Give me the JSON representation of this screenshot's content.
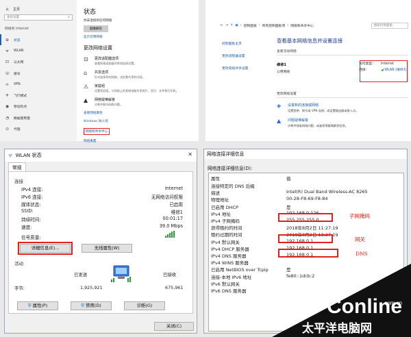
{
  "settings": {
    "home": "主页",
    "search_placeholder": "查找设置",
    "section": "网络和 Internet",
    "nav": [
      {
        "icon": "⊕",
        "label": "状态"
      },
      {
        "icon": "ᯤ",
        "label": "WLAN"
      },
      {
        "icon": "⊡",
        "label": "以太网"
      },
      {
        "icon": "☏",
        "label": "拨号"
      },
      {
        "icon": "∞",
        "label": "VPN"
      },
      {
        "icon": "✈",
        "label": "飞行模式"
      },
      {
        "icon": "◉",
        "label": "移动热点"
      },
      {
        "icon": "◔",
        "label": "数据使用量"
      },
      {
        "icon": "⊙",
        "label": "代理"
      }
    ],
    "title": "状态",
    "status_text": "你未连接到任何网络",
    "troubleshoot_btn": "疑难解答",
    "available_link": "显示可用网络",
    "change_title": "更改网络设置",
    "options": [
      {
        "icon": "⊡",
        "title": "更改适配器选项",
        "desc": "查看网络适配器并更改连接设置。"
      },
      {
        "icon": "⌂",
        "title": "共享选项",
        "desc": "针对连接到的网络，决定要共享的内容。"
      },
      {
        "icon": "⚠",
        "title": "家庭组",
        "desc": "设置家庭组，与网络上的其他电脑共享照片、音乐、文件和打印机。"
      },
      {
        "icon": "▲",
        "title": "网络疑难解答",
        "desc": "诊断并解决网络问题。"
      }
    ],
    "links": [
      "查看网络属性",
      "Windows 防火墙",
      "网络和共享中心",
      "网络重置"
    ]
  },
  "nsc": {
    "breadcrumb": [
      "控制面板",
      "所有控制面板项",
      "网络和共享中心"
    ],
    "search": "搜索控制面板",
    "left_links": [
      "控制面板主页",
      "更改适配器设置",
      "更改高级共享设置"
    ],
    "heading": "查看基本网络信息并设置连接",
    "active_networks": "查看活动网络",
    "network_name": "维修1",
    "network_kind": "公用网络",
    "access_type_label": "访问类型：",
    "access_type_value": "Internet",
    "connection_label": "连接：",
    "connection_value": "WLAN (维修1)",
    "change_settings": "更改网络设置",
    "actions": [
      {
        "icon": "◈",
        "title": "设置新的连接或网络",
        "desc": "设置宽带、拨号或 VPN 连接；或设置路由器或接入点。"
      },
      {
        "icon": "▲",
        "title": "问题疑难解答",
        "desc": "诊断并修复网络问题，或者获得疑难解答信息。"
      }
    ]
  },
  "wlan": {
    "title": "WLAN 状态",
    "close": "✕",
    "tab": "常规",
    "connection_group": "连接",
    "fields": [
      {
        "label": "IPv4 连接:",
        "value": "Internet"
      },
      {
        "label": "IPv6 连接:",
        "value": "无网络访问权限"
      },
      {
        "label": "媒体状态:",
        "value": "已启用"
      },
      {
        "label": "SSID:",
        "value": "维修1"
      },
      {
        "label": "持续时间:",
        "value": "00:01:17"
      },
      {
        "label": "速度:",
        "value": "39.0 Mbps"
      }
    ],
    "signal_label": "信号质量:",
    "details_btn": "详细信息(E)...",
    "wireless_props_btn": "无线属性(W)",
    "activity_group": "活动",
    "sent": "已发送",
    "received": "已接收",
    "bytes_label": "字节:",
    "bytes_sent": "1,925,921",
    "bytes_received": "675,961",
    "props_btn": "属性(P)",
    "disable_btn": "禁用(D)",
    "diagnose_btn": "诊断(G)",
    "close_btn": "关闭(C)"
  },
  "details": {
    "title": "网络连接详细信息",
    "label": "网络连接详细信息(D):",
    "header": {
      "p": "属性",
      "v": "值"
    },
    "rows": [
      {
        "p": "连接特定的 DNS 后缀",
        "v": ""
      },
      {
        "p": "描述",
        "v": "Intel(R) Dual Band Wireless-AC 8265"
      },
      {
        "p": "物理地址",
        "v": "00-28-F8-69-F8-84"
      },
      {
        "p": "已启用 DHCP",
        "v": "是"
      },
      {
        "p": "IPv4 地址",
        "v": "192.168.0.126"
      },
      {
        "p": "IPv4 子网掩码",
        "v": "255.255.255.0"
      },
      {
        "p": "获得租约的时间",
        "v": "2018年8月2日 11:27:19"
      },
      {
        "p": "租约过期的时间",
        "v": "2018年8月2日 13:27:19"
      },
      {
        "p": "IPv4 默认网关",
        "v": "192.168.0.1"
      },
      {
        "p": "IPv4 DHCP 服务器",
        "v": "192.168.0.1"
      },
      {
        "p": "IPv4 DNS 服务器",
        "v": "192.168.0.1"
      },
      {
        "p": "IPv4 WINS 服务器",
        "v": ""
      },
      {
        "p": "已启用 NetBIOS over Tcpip",
        "v": "是"
      },
      {
        "p": "连接-本地 IPv6 地址",
        "v": "fe80::1dcb:2"
      },
      {
        "p": "IPv6 默认网关",
        "v": ""
      },
      {
        "p": "IPv6 DNS 服务器",
        "v": ""
      }
    ],
    "annotations": {
      "subnet": "子网掩码",
      "gateway": "网关",
      "dns": "DNS"
    }
  },
  "watermark": {
    "brand": "PConline",
    "domain": ".com.cn",
    "cn": "太平洋电脑网"
  }
}
